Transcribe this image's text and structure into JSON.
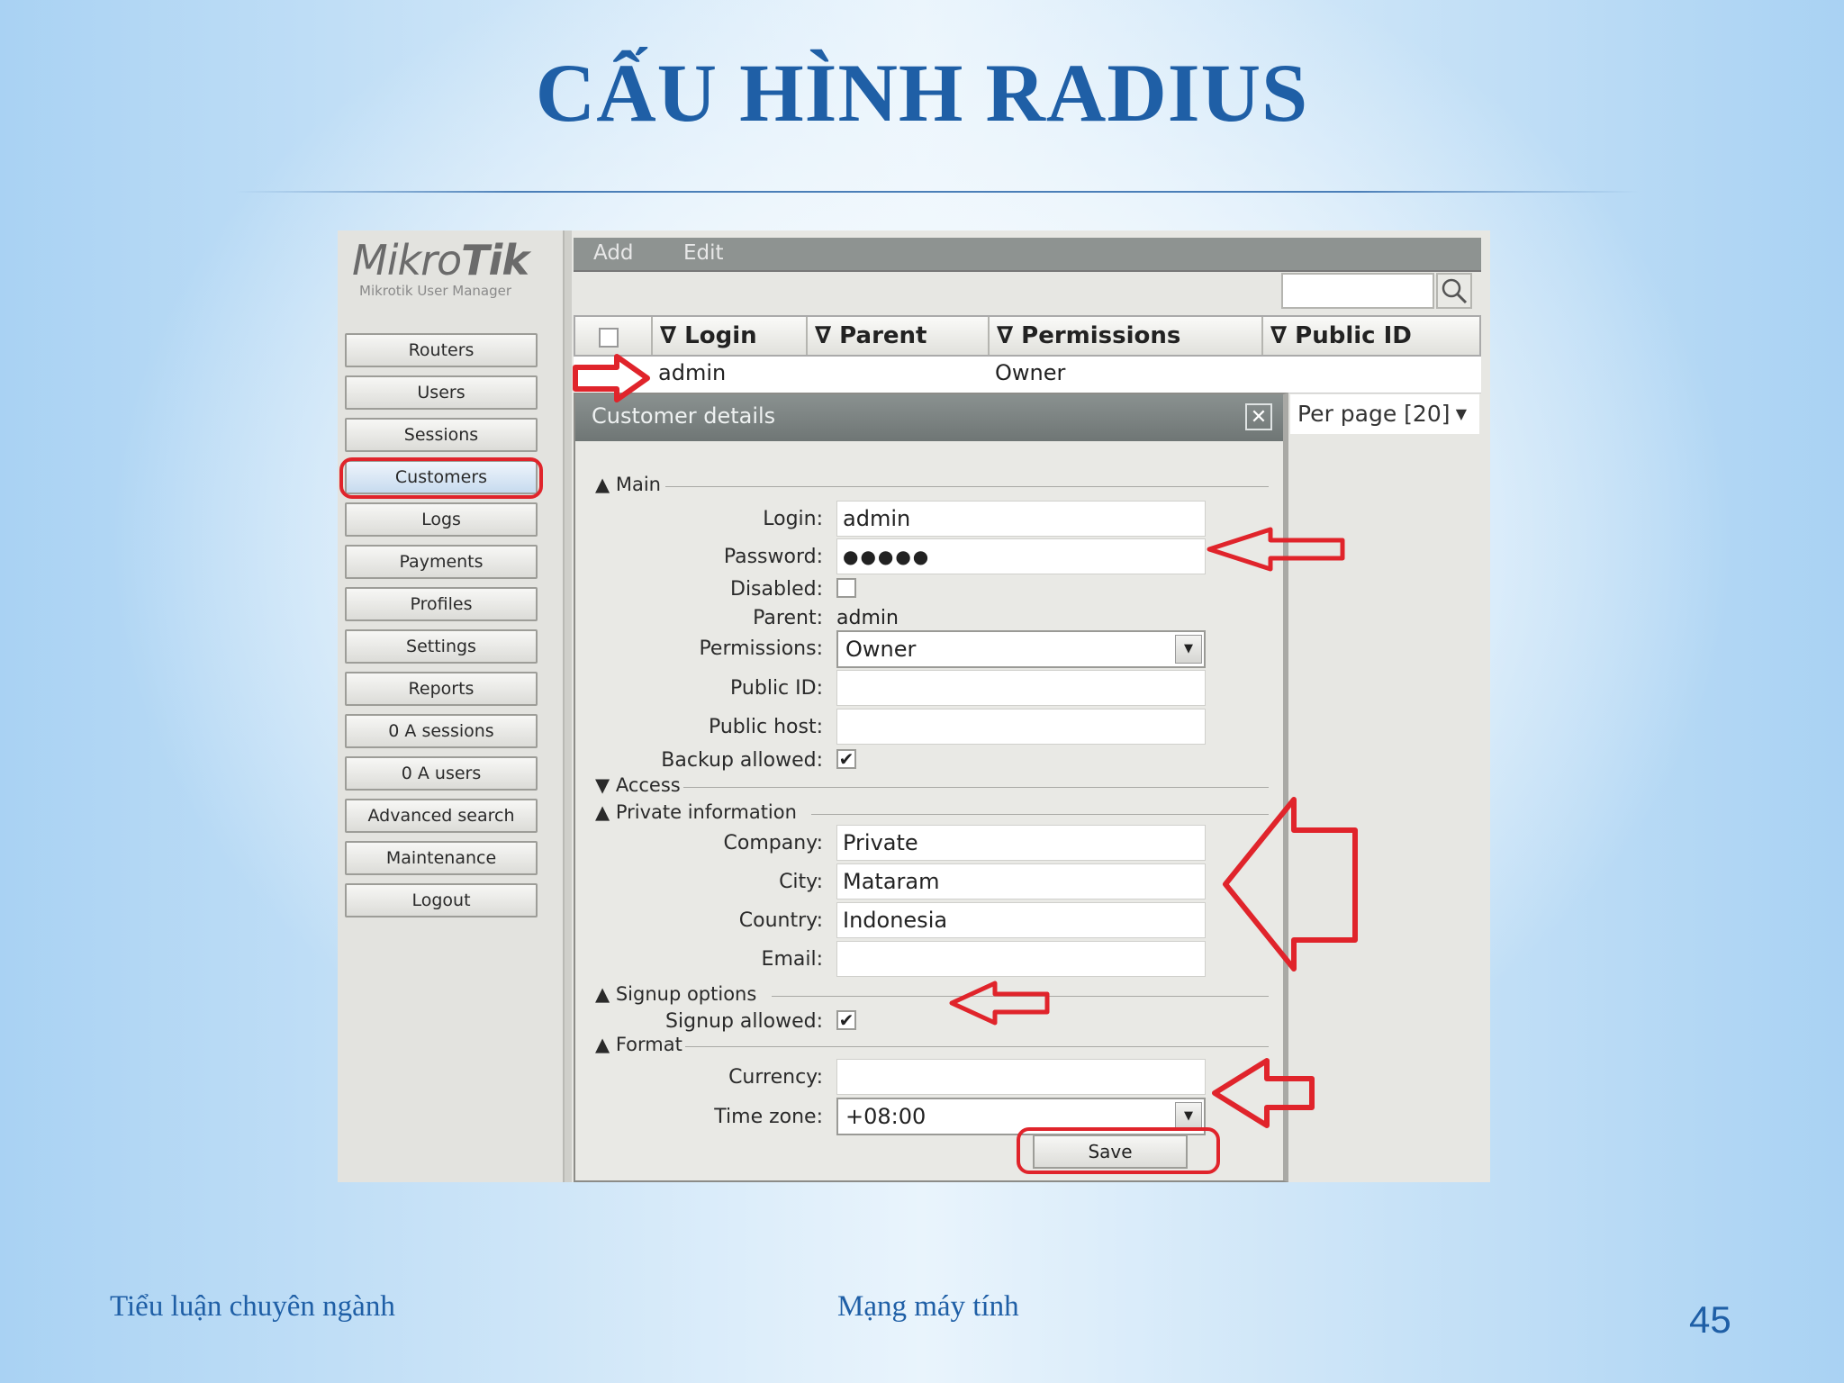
{
  "slide": {
    "title": "CẤU HÌNH RADIUS",
    "footer_left": "Tiểu luận chuyên ngành",
    "footer_center": "Mạng máy tính",
    "page_number": "45",
    "title_color": "#1f5fa6"
  },
  "app": {
    "logo_light": "Mikro",
    "logo_bold": "Tik",
    "logo_subtitle": "Mikrotik User Manager",
    "nav": [
      {
        "label": "Routers"
      },
      {
        "label": "Users"
      },
      {
        "label": "Sessions"
      },
      {
        "label": "Customers",
        "active": true
      },
      {
        "label": "Logs"
      },
      {
        "label": "Payments"
      },
      {
        "label": "Profiles"
      },
      {
        "label": "Settings"
      },
      {
        "label": "Reports"
      },
      {
        "label": "0 A sessions"
      },
      {
        "label": "0 A users"
      },
      {
        "label": "Advanced search"
      },
      {
        "label": "Maintenance"
      },
      {
        "label": "Logout"
      }
    ],
    "toolbar": {
      "add": "Add",
      "edit": "Edit"
    },
    "search": {
      "placeholder": "",
      "icon": "magnifier-icon"
    },
    "grid": {
      "columns": [
        "∇ Login",
        "∇ Parent",
        "∇ Permissions",
        "∇ Public ID"
      ],
      "rows": [
        {
          "login": "admin",
          "parent": "",
          "permissions": "Owner",
          "public_id": ""
        }
      ]
    },
    "per_page": "Per page [20]"
  },
  "dialog": {
    "title": "Customer details",
    "sections": {
      "main": "Main",
      "access": "Access",
      "private_information": "Private information",
      "signup_options": "Signup options",
      "format": "Format"
    },
    "fields": {
      "login": {
        "label": "Login:",
        "value": "admin"
      },
      "password": {
        "label": "Password:",
        "value": "●●●●●"
      },
      "disabled": {
        "label": "Disabled:",
        "checked": false
      },
      "parent": {
        "label": "Parent:",
        "value": "admin"
      },
      "permissions": {
        "label": "Permissions:",
        "value": "Owner"
      },
      "public_id": {
        "label": "Public ID:",
        "value": ""
      },
      "public_host": {
        "label": "Public host:",
        "value": ""
      },
      "backup_allowed": {
        "label": "Backup allowed:",
        "checked": true
      },
      "company": {
        "label": "Company:",
        "value": "Private"
      },
      "city": {
        "label": "City:",
        "value": "Mataram"
      },
      "country": {
        "label": "Country:",
        "value": "Indonesia"
      },
      "email": {
        "label": "Email:",
        "value": ""
      },
      "signup_allowed": {
        "label": "Signup allowed:",
        "checked": true
      },
      "currency": {
        "label": "Currency:",
        "value": ""
      },
      "time_zone": {
        "label": "Time zone:",
        "value": "+08:00"
      }
    },
    "save_label": "Save",
    "check_glyph": "✔",
    "annotation_color": "#e0242b"
  }
}
